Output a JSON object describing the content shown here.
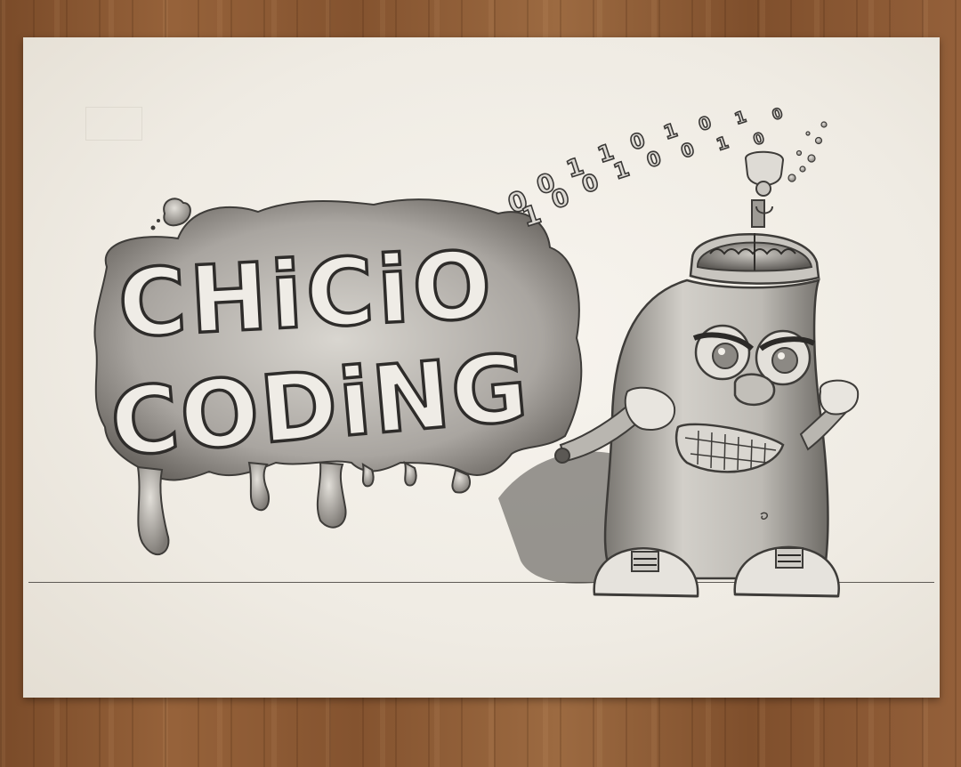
{
  "artwork": {
    "title_line1": "CHiCiO",
    "title_line2": "CODiNG",
    "binary_stream": [
      "0",
      "1",
      "0",
      "0",
      "1",
      "0",
      "1",
      "1",
      "0",
      "0",
      "1",
      "0",
      "0",
      "1",
      "1",
      "0",
      "0"
    ],
    "emboss_text": "",
    "colors": {
      "wood": "#8a5a33",
      "paper": "#f3efe8",
      "pencil_dark": "#3a3a3a",
      "pencil_mid": "#8c8c8c"
    }
  }
}
